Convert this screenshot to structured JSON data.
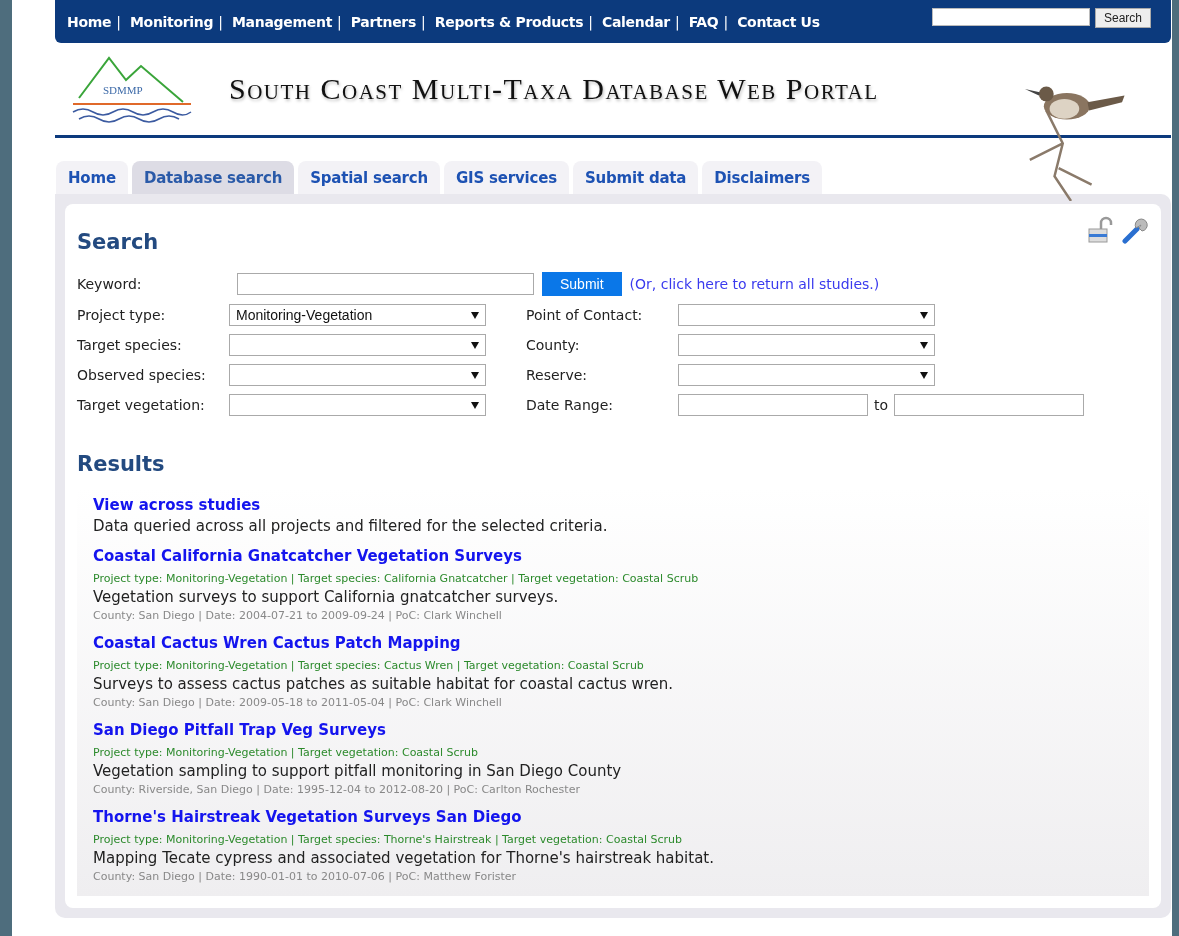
{
  "top_nav": {
    "items": [
      {
        "label": "Home",
        "separator": "|"
      },
      {
        "label": "Monitoring",
        "separator": "|"
      },
      {
        "label": "Management",
        "separator": "|"
      },
      {
        "label": "Partners",
        "separator": "|"
      },
      {
        "label": "Reports & Products",
        "separator": "|"
      },
      {
        "label": "Calendar",
        "separator": "|"
      },
      {
        "label": "FAQ",
        "separator": "|"
      },
      {
        "label": "Contact Us"
      }
    ],
    "search_button": "Search"
  },
  "header": {
    "logo_text": "SDMMP",
    "title": "South Coast Multi-Taxa Database Web Portal"
  },
  "tabs": [
    {
      "label": "Home",
      "selected": false
    },
    {
      "label": "Database search",
      "selected": true
    },
    {
      "label": "Spatial search",
      "selected": false
    },
    {
      "label": "GIS services",
      "selected": false
    },
    {
      "label": "Submit data",
      "selected": false
    },
    {
      "label": "Disclaimers",
      "selected": false
    }
  ],
  "search": {
    "heading": "Search",
    "keyword_label": "Keyword:",
    "submit": "Submit",
    "return_all_link": "(Or, click here to return all studies.)",
    "left_fields": [
      {
        "label": "Project type:",
        "kind": "select",
        "value": "Monitoring-Vegetation"
      },
      {
        "label": "Target species:",
        "kind": "select"
      },
      {
        "label": "Observed species:",
        "kind": "select"
      },
      {
        "label": "Target vegetation:",
        "kind": "select"
      }
    ],
    "right_fields": [
      {
        "label": "Point of Contact:",
        "kind": "select"
      },
      {
        "label": "County:",
        "kind": "select"
      },
      {
        "label": "Reserve:",
        "kind": "select"
      },
      {
        "label": "Date Range:",
        "kind": "date_range",
        "joiner": "to"
      }
    ]
  },
  "results": {
    "heading": "Results",
    "items": [
      {
        "title": "View across studies",
        "description": "Data queried across all projects and filtered for the selected criteria."
      },
      {
        "title": "Coastal California Gnatcatcher Vegetation Surveys",
        "meta": "Project type: Monitoring-Vegetation | Target species: California Gnatcatcher | Target vegetation: Coastal Scrub",
        "description": "Vegetation surveys to support California gnatcatcher surveys.",
        "details": "County: San Diego | Date: 2004-07-21 to 2009-09-24 | PoC: Clark Winchell"
      },
      {
        "title": "Coastal Cactus Wren Cactus Patch Mapping",
        "meta": "Project type: Monitoring-Vegetation | Target species: Cactus Wren | Target vegetation: Coastal Scrub",
        "description": "Surveys to assess cactus patches as suitable habitat for coastal cactus wren.",
        "details": "County: San Diego | Date: 2009-05-18 to 2011-05-04 | PoC: Clark Winchell"
      },
      {
        "title": "San Diego Pitfall Trap Veg Surveys",
        "meta": "Project type: Monitoring-Vegetation | Target vegetation: Coastal Scrub",
        "description": "Vegetation sampling to support pitfall monitoring in San Diego County",
        "details": "County: Riverside, San Diego | Date: 1995-12-04 to 2012-08-20 | PoC: Carlton Rochester"
      },
      {
        "title": "Thorne's Hairstreak Vegetation Surveys San Diego",
        "meta": "Project type: Monitoring-Vegetation | Target species: Thorne's Hairstreak | Target vegetation: Coastal Scrub",
        "description": "Mapping Tecate cypress and associated vegetation for Thorne's hairstreak habitat.",
        "details": "County: San Diego | Date: 1990-01-01 to 2010-07-06 | PoC: Matthew Forister"
      }
    ]
  }
}
